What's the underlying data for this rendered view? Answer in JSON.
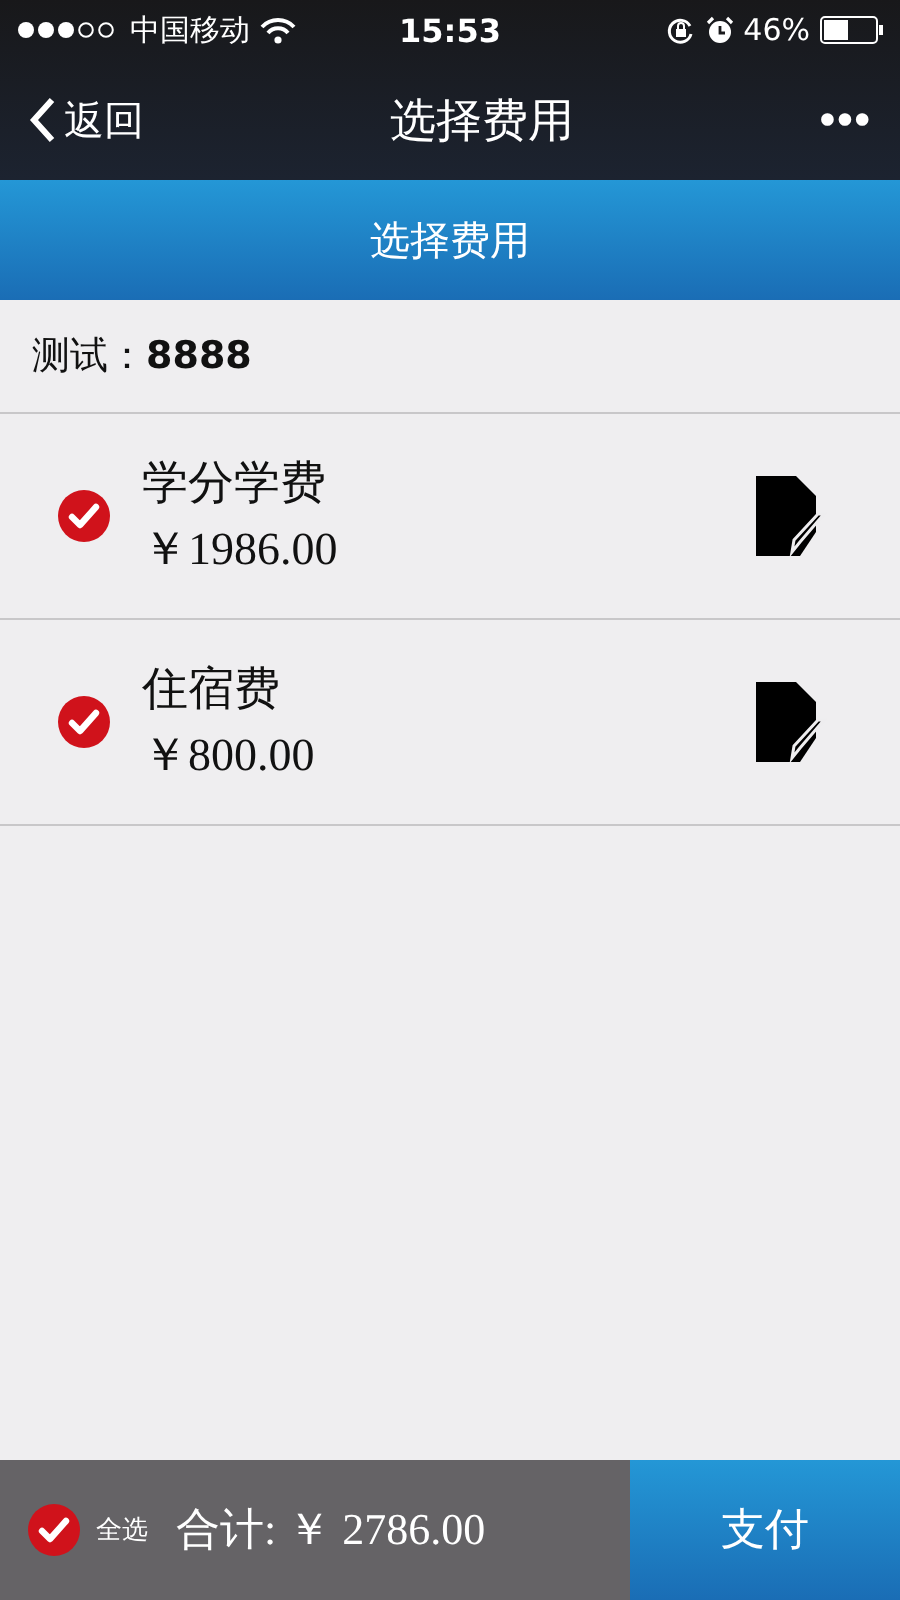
{
  "status_bar": {
    "carrier": "中国移动",
    "time": "15:53",
    "battery": "46%"
  },
  "nav": {
    "back": "返回",
    "title": "选择费用",
    "more": "•••"
  },
  "header": {
    "title": "选择费用"
  },
  "account": "测试：**8888**",
  "fees": [
    {
      "name": "学分学费",
      "amount": "￥1986.00",
      "checked": true
    },
    {
      "name": "住宿费",
      "amount": "￥800.00",
      "checked": true
    }
  ],
  "footer": {
    "select_all": {
      "label": "全选",
      "checked": true
    },
    "total": "合计: ￥ 2786.00",
    "pay": "支付"
  }
}
